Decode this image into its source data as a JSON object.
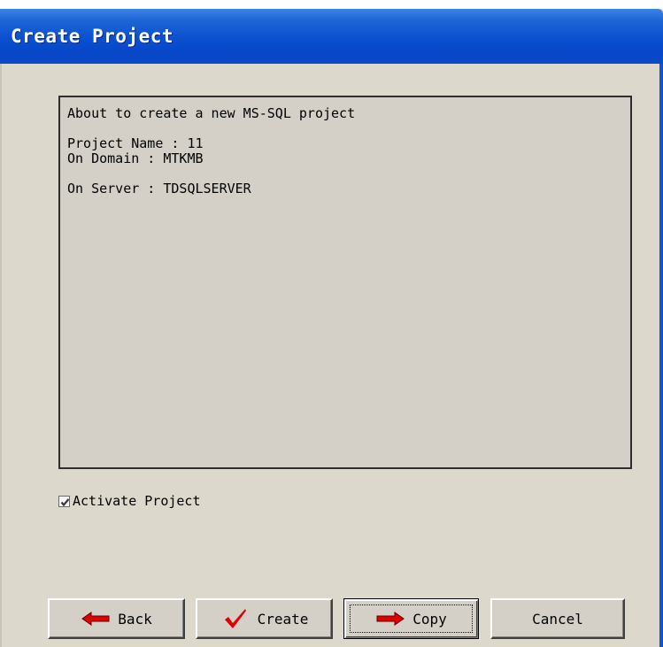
{
  "window": {
    "title": "Create Project"
  },
  "summary": {
    "line1": "About to create a new MS-SQL project",
    "project_name": "Project Name : 11",
    "domain": "On Domain : MTKMB",
    "server": "On Server : TDSQLSERVER"
  },
  "activate": {
    "label": "Activate Project",
    "checked": true
  },
  "buttons": {
    "back": {
      "label": "Back",
      "icon": "red-left-arrow-icon"
    },
    "create": {
      "label": "Create",
      "icon": "red-checkmark-icon"
    },
    "copy": {
      "label": "Copy",
      "icon": "red-right-arrow-icon"
    },
    "cancel": {
      "label": "Cancel"
    }
  },
  "colors": {
    "title_bar": "#0a4fd0",
    "dialog_bg": "#dcd8cc",
    "icon_red": "#e00000"
  }
}
